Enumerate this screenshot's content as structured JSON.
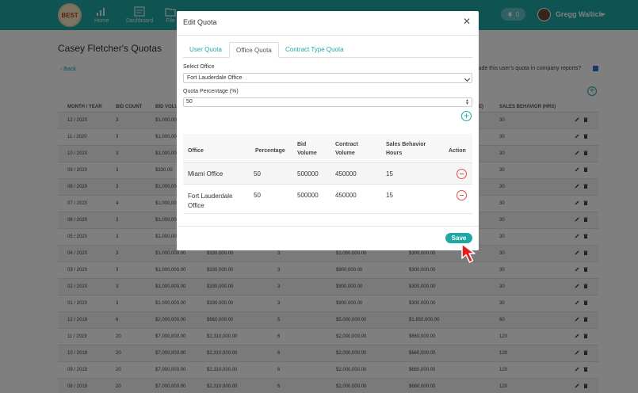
{
  "nav": {
    "logo_text": "BEST",
    "items": [
      {
        "label": "Home",
        "icon": "chart-icon"
      },
      {
        "label": "Dashboard",
        "icon": "dashboard-icon"
      },
      {
        "label": "File",
        "icon": "folder-icon"
      }
    ],
    "notifications": "0",
    "user_name": "Gregg Wallick"
  },
  "page": {
    "title": "Casey Fletcher's Quotas",
    "back_label": "Back",
    "report_question": "lude this user's quota in company reports?",
    "report_checked": true
  },
  "bg_table": {
    "headers": {
      "month": "MONTH / YEAR",
      "bid_count": "BID COUNT",
      "bid_vol": "BID VOLU",
      "sales_behavior": "SALES BEHAVIOR (HRS)",
      "frag": "E)"
    },
    "rows": [
      {
        "month": "12 / 2020",
        "bid_count": "3",
        "bid_volume": "$1,000,00",
        "sales": "30"
      },
      {
        "month": "11 / 2020",
        "bid_count": "3",
        "bid_volume": "$1,000,00",
        "sales": "30"
      },
      {
        "month": "10 / 2020",
        "bid_count": "3",
        "bid_volume": "$1,000,00",
        "sales": "30"
      },
      {
        "month": "09 / 2020",
        "bid_count": "3",
        "bid_volume": "$330,00",
        "sales": "30"
      },
      {
        "month": "08 / 2020",
        "bid_count": "3",
        "bid_volume": "$1,000,00",
        "sales": "30"
      },
      {
        "month": "07 / 2020",
        "bid_count": "4",
        "bid_volume": "$1,000,00",
        "sales": "30"
      },
      {
        "month": "06 / 2020",
        "bid_count": "3",
        "bid_volume": "$1,000,00",
        "sales": "30"
      },
      {
        "month": "05 / 2020",
        "bid_count": "3",
        "bid_volume": "$1,000,00",
        "sales": "30"
      },
      {
        "month": "04 / 2020",
        "bid_count": "3",
        "bid_volume": "$1,000,000.00",
        "c4": "$330,000.00",
        "c5": "3",
        "c6": "$1,050,000.00",
        "c7": "$300,000.00",
        "sales": "30"
      },
      {
        "month": "03 / 2020",
        "bid_count": "3",
        "bid_volume": "$1,000,000.00",
        "c4": "$330,000.00",
        "c5": "3",
        "c6": "$900,000.00",
        "c7": "$300,000.00",
        "sales": "30"
      },
      {
        "month": "02 / 2020",
        "bid_count": "3",
        "bid_volume": "$1,000,000.00",
        "c4": "$330,000.00",
        "c5": "3",
        "c6": "$900,000.00",
        "c7": "$300,000.00",
        "sales": "30"
      },
      {
        "month": "01 / 2020",
        "bid_count": "3",
        "bid_volume": "$1,000,000.00",
        "c4": "$330,000.00",
        "c5": "3",
        "c6": "$900,000.00",
        "c7": "$300,000.00",
        "sales": "30"
      },
      {
        "month": "12 / 2019",
        "bid_count": "6",
        "bid_volume": "$2,000,000.00",
        "c4": "$660,000.00",
        "c5": "5",
        "c6": "$5,000,000.00",
        "c7": "$1,650,000.00",
        "sales": "60"
      },
      {
        "month": "11 / 2019",
        "bid_count": "20",
        "bid_volume": "$7,000,000.00",
        "c4": "$2,310,000.00",
        "c5": "6",
        "c6": "$2,000,000.00",
        "c7": "$660,000.00",
        "sales": "120"
      },
      {
        "month": "10 / 2019",
        "bid_count": "20",
        "bid_volume": "$7,000,000.00",
        "c4": "$2,310,000.00",
        "c5": "6",
        "c6": "$2,000,000.00",
        "c7": "$660,000.00",
        "sales": "120"
      },
      {
        "month": "09 / 2019",
        "bid_count": "20",
        "bid_volume": "$7,000,000.00",
        "c4": "$2,310,000.00",
        "c5": "6",
        "c6": "$2,000,000.00",
        "c7": "$660,000.00",
        "sales": "120"
      },
      {
        "month": "08 / 2019",
        "bid_count": "20",
        "bid_volume": "$7,000,000.00",
        "c4": "$2,310,000.00",
        "c5": "6",
        "c6": "$2,000,000.00",
        "c7": "$660,000.00",
        "sales": "120"
      }
    ]
  },
  "modal": {
    "title": "Edit Quota",
    "close": "✕",
    "tabs": [
      "User Quota",
      "Office Quota",
      "Contract Type Quota"
    ],
    "active_tab": "Office Quota",
    "select_label": "Select Office",
    "select_value": "Fort Lauderdale Office",
    "pct_label": "Quota Percentage (%)",
    "pct_value": "50",
    "table": {
      "headers": [
        "Office",
        "Percentage",
        "Bid Volume",
        "Contract Volume",
        "Sales Behavior Hours",
        "Action"
      ],
      "rows": [
        {
          "office": "Miami Office",
          "percentage": "50",
          "bid_volume": "500000",
          "contract_volume": "450000",
          "sales_hours": "15"
        },
        {
          "office": "Fort Lauderdale Office",
          "percentage": "50",
          "bid_volume": "500000",
          "contract_volume": "450000",
          "sales_hours": "15"
        }
      ]
    },
    "save_label": "Save"
  },
  "colors": {
    "accent": "#1ea7a7",
    "danger": "#d9534f",
    "cursor": "#e02020"
  }
}
